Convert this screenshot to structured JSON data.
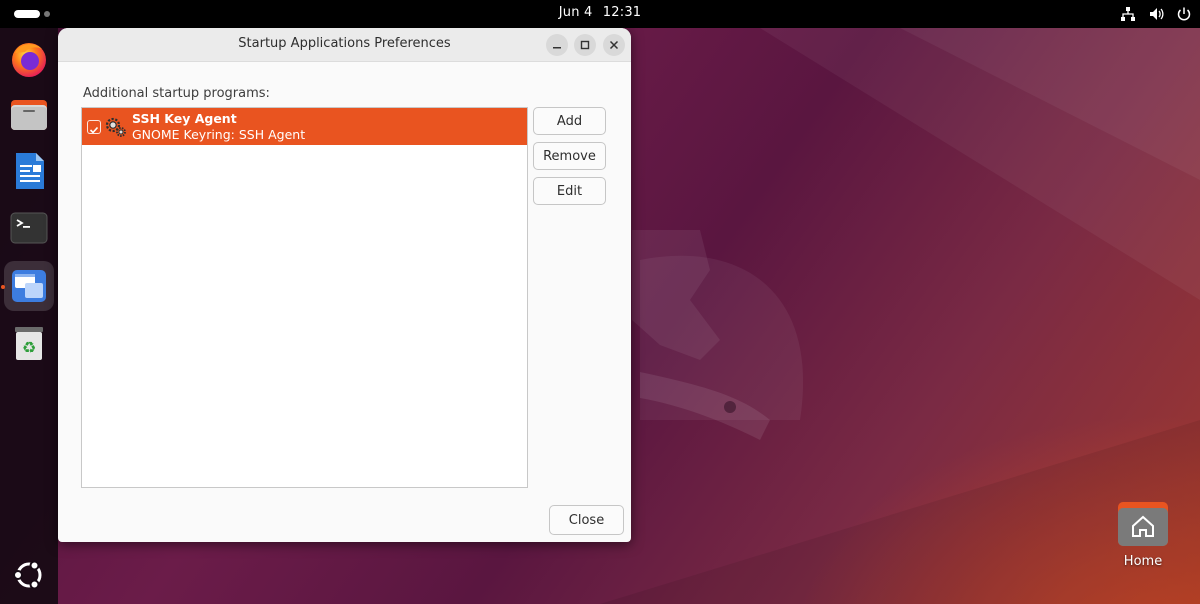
{
  "topbar": {
    "date": "Jun 4",
    "time": "12:31",
    "tray_icons": [
      "network-icon",
      "volume-icon",
      "power-icon"
    ]
  },
  "dock": {
    "items": [
      {
        "name": "firefox",
        "icon": "firefox-icon"
      },
      {
        "name": "files",
        "icon": "files-icon"
      },
      {
        "name": "libreoffice-writer",
        "icon": "writer-icon"
      },
      {
        "name": "terminal",
        "icon": "terminal-icon"
      },
      {
        "name": "startup-applications",
        "icon": "startup-apps-icon",
        "active": true
      },
      {
        "name": "trash",
        "icon": "trash-icon"
      }
    ],
    "show_apps_icon": "ubuntu-logo-icon"
  },
  "dialog": {
    "title": "Startup Applications Preferences",
    "section_label": "Additional startup programs:",
    "programs": [
      {
        "name": "SSH Key Agent",
        "description": "GNOME Keyring: SSH Agent",
        "enabled": true,
        "selected": true
      }
    ],
    "buttons": {
      "add": "Add",
      "remove": "Remove",
      "edit": "Edit",
      "close": "Close"
    }
  },
  "desktop": {
    "home_label": "Home"
  },
  "colors": {
    "accent": "#e95420",
    "topbar": "#000000",
    "dialog_bg": "#fafafa"
  }
}
